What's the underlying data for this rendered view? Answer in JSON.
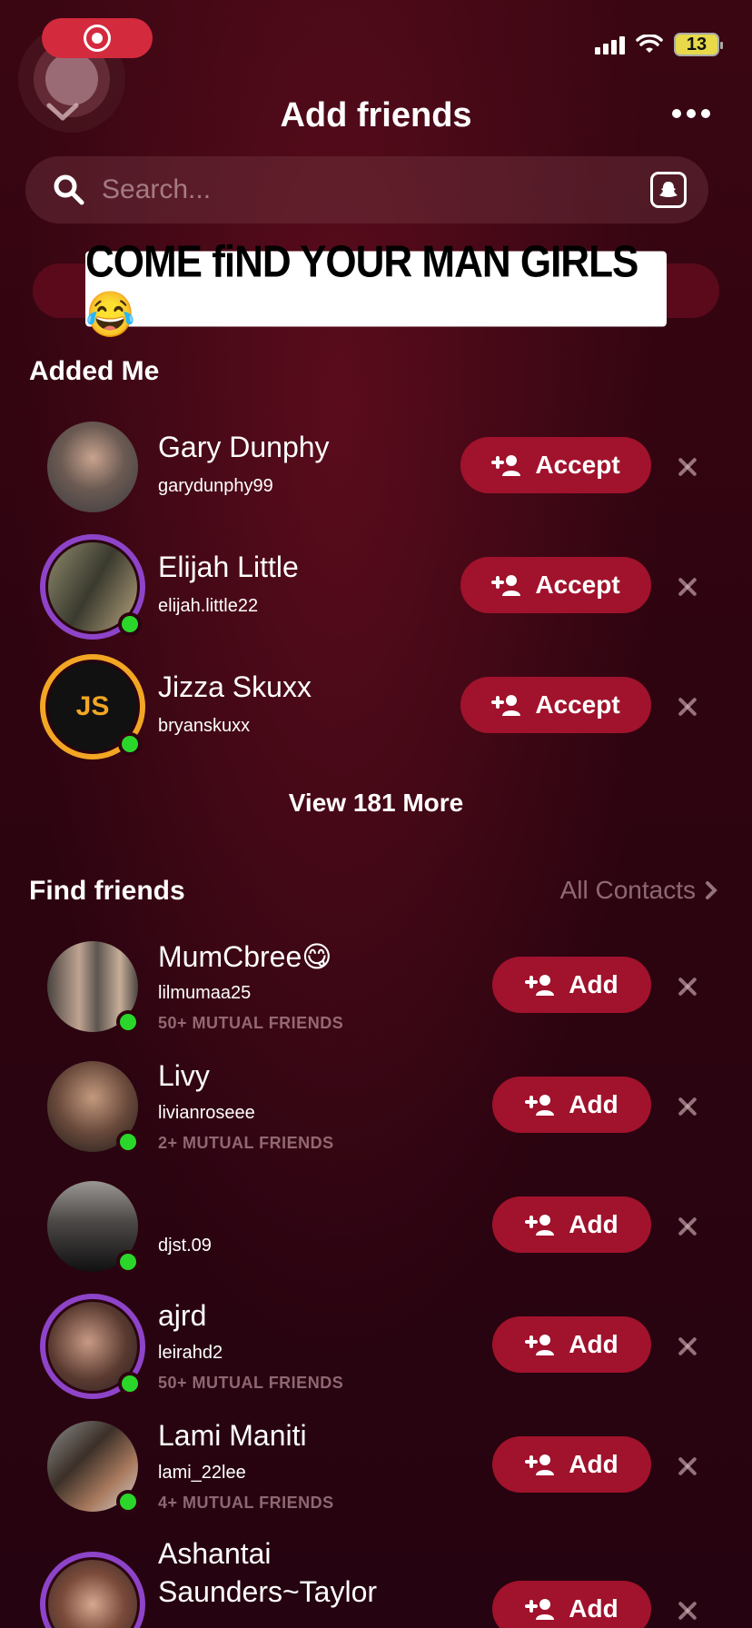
{
  "status_bar": {
    "battery": "13"
  },
  "header": {
    "title": "Add friends"
  },
  "search": {
    "placeholder": "Search..."
  },
  "banner": {
    "text": "COME fiND YOUR MAN GIRLS 😂"
  },
  "added_me": {
    "title": "Added Me",
    "action_label": "Accept",
    "items": [
      {
        "name": "Gary Dunphy",
        "username": "garydunphy99"
      },
      {
        "name": "Elijah Little",
        "username": "elijah.little22"
      },
      {
        "name": "Jizza Skuxx",
        "username": "bryanskuxx",
        "initials": "JS"
      }
    ],
    "view_more": "View 181 More"
  },
  "find_friends": {
    "title": "Find friends",
    "all_contacts": "All Contacts",
    "action_label": "Add",
    "items": [
      {
        "name": "MumCbree😋",
        "username": "lilmumaa25",
        "mutual": "50+ MUTUAL FRIENDS"
      },
      {
        "name": "Livy",
        "username": "livianroseee",
        "mutual": "2+ MUTUAL FRIENDS"
      },
      {
        "name": "",
        "username": "djst.09",
        "mutual": ""
      },
      {
        "name": "ajrd",
        "username": "leirahd2",
        "mutual": "50+ MUTUAL FRIENDS"
      },
      {
        "name": "Lami Maniti",
        "username": "lami_22lee",
        "mutual": "4+ MUTUAL FRIENDS"
      },
      {
        "name": "Ashantai",
        "name_line2": "Saunders~Taylor",
        "username": "",
        "mutual": ""
      }
    ]
  },
  "colors": {
    "accent": "#a1122c",
    "online": "#2bd62b",
    "story_ring_purple": "#8e44c9",
    "story_ring_gold": "#f2a623"
  }
}
